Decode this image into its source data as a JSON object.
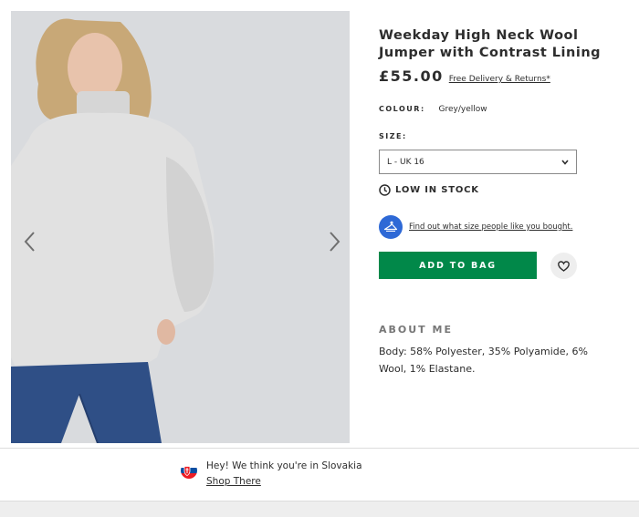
{
  "gallery": {
    "image_alt": "Model wearing grey high neck jumper with blue jeans",
    "prev_icon": "chevron-left-icon",
    "next_icon": "chevron-right-icon"
  },
  "product": {
    "title": "Weekday High Neck Wool Jumper with Contrast Lining",
    "price": "£55.00",
    "delivery_link": "Free Delivery & Returns*",
    "colour_label": "COLOUR:",
    "colour_value": "Grey/yellow",
    "size_label": "SIZE:",
    "size_selected": "L - UK 16",
    "stock_status": "LOW IN STOCK",
    "fit_link": "Find out what size people like you bought.",
    "add_to_bag": "ADD TO BAG",
    "about_heading": "ABOUT ME",
    "about_body": "Body: 58% Polyester, 35% Polyamide, 6% Wool, 1% Elastane."
  },
  "geo_banner": {
    "message": "Hey! We think you're in Slovakia",
    "link": "Shop There",
    "flag_icon": "slovakia-flag-icon"
  },
  "colors": {
    "add_to_bag_bg": "#018849",
    "fit_badge_bg": "#2e69d6",
    "image_bg": "#d9dbde"
  }
}
